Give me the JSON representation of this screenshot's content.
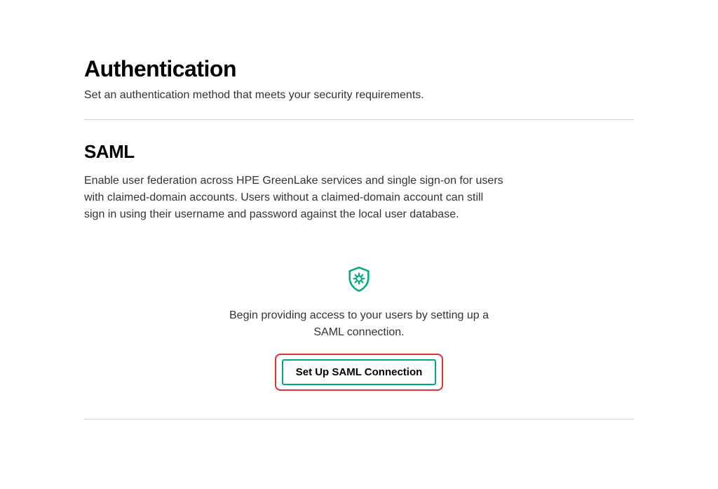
{
  "page": {
    "title": "Authentication",
    "subtitle": "Set an authentication method that meets your security requirements."
  },
  "saml": {
    "title": "SAML",
    "description": "Enable user federation across HPE GreenLake services and single sign-on for users with claimed-domain accounts. Users without a claimed-domain account can still sign in using their username and password against the local user database.",
    "cta_text": "Begin providing access to your users by setting up a SAML connection.",
    "button_label": "Set Up SAML Connection"
  },
  "colors": {
    "accent": "#01a982",
    "highlight_border": "#e03030"
  }
}
